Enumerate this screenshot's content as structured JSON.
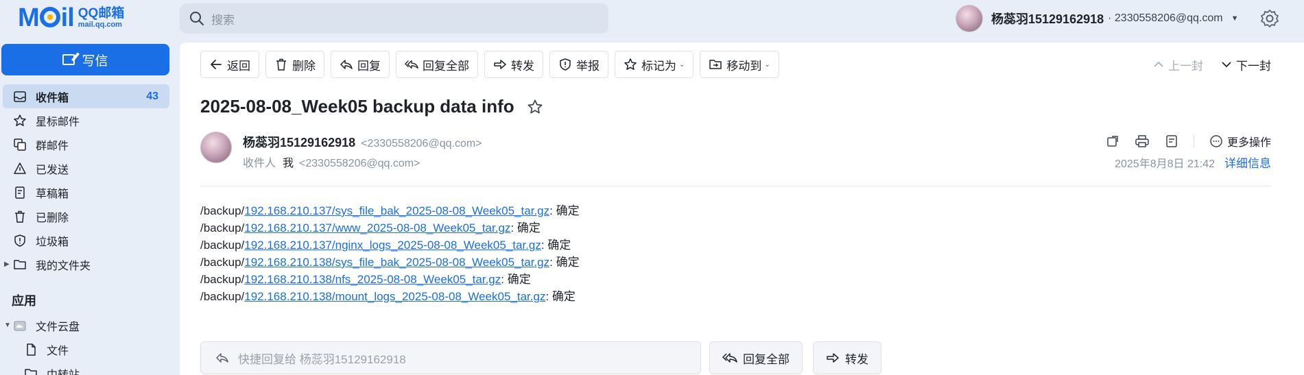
{
  "logo": {
    "word_left": "M",
    "word_right": "il",
    "title": "QQ邮箱",
    "domain": "mail.qq.com"
  },
  "search": {
    "placeholder": "搜索"
  },
  "user": {
    "name": "杨蕊羽15129162918",
    "email": "· 2330558206@qq.com"
  },
  "sidebar": {
    "compose_label": "写信",
    "items": [
      {
        "label": "收件箱",
        "count": "43",
        "icon": "inbox-icon"
      },
      {
        "label": "星标邮件",
        "icon": "star-icon"
      },
      {
        "label": "群邮件",
        "icon": "group-mail-icon"
      },
      {
        "label": "已发送",
        "icon": "sent-icon"
      },
      {
        "label": "草稿箱",
        "icon": "draft-icon"
      },
      {
        "label": "已删除",
        "icon": "trash-icon"
      },
      {
        "label": "垃圾箱",
        "icon": "spam-icon"
      },
      {
        "label": "我的文件夹",
        "icon": "folder-icon"
      }
    ],
    "apps_title": "应用",
    "apps": [
      {
        "label": "文件云盘",
        "icon": "cloud-drive-icon"
      },
      {
        "label": "文件",
        "icon": "file-icon"
      },
      {
        "label": "中转站",
        "icon": "folder-icon"
      }
    ]
  },
  "toolbar": {
    "back": "返回",
    "delete": "删除",
    "reply": "回复",
    "reply_all": "回复全部",
    "forward": "转发",
    "report": "举报",
    "mark_as": "标记为",
    "move_to": "移动到"
  },
  "pager": {
    "prev": "上一封",
    "next": "下一封"
  },
  "mail": {
    "subject": "2025-08-08_Week05 backup data info",
    "sender_name": "杨蕊羽15129162918",
    "sender_email": "<2330558206@qq.com>",
    "recipient_label": "收件人",
    "recipient_me": "我",
    "recipient_email": "<2330558206@qq.com>",
    "date": "2025年8月8日 21:42",
    "detail_link": "详细信息",
    "more_ops": "更多操作",
    "body": [
      {
        "prefix": "/backup/",
        "link": "192.168.210.137/sys_file_bak_2025-08-08_Week05_tar.gz",
        "suffix": ": 确定"
      },
      {
        "prefix": "/backup/",
        "link": "192.168.210.137/www_2025-08-08_Week05_tar.gz",
        "suffix": ": 确定"
      },
      {
        "prefix": "/backup/",
        "link": "192.168.210.137/nginx_logs_2025-08-08_Week05_tar.gz",
        "suffix": ": 确定"
      },
      {
        "prefix": "/backup/",
        "link": "192.168.210.138/sys_file_bak_2025-08-08_Week05_tar.gz",
        "suffix": ": 确定"
      },
      {
        "prefix": "/backup/",
        "link": "192.168.210.138/nfs_2025-08-08_Week05_tar.gz",
        "suffix": ": 确定"
      },
      {
        "prefix": "/backup/",
        "link": "192.168.210.138/mount_logs_2025-08-08_Week05_tar.gz",
        "suffix": ": 确定"
      }
    ]
  },
  "footer": {
    "quick_reply": "快捷回复给 杨蕊羽15129162918",
    "reply_all": "回复全部",
    "forward": "转发"
  },
  "colors": {
    "accent": "#1a6ee6",
    "page_bg": "#e8eef7",
    "active_nav": "#c9daf1"
  }
}
